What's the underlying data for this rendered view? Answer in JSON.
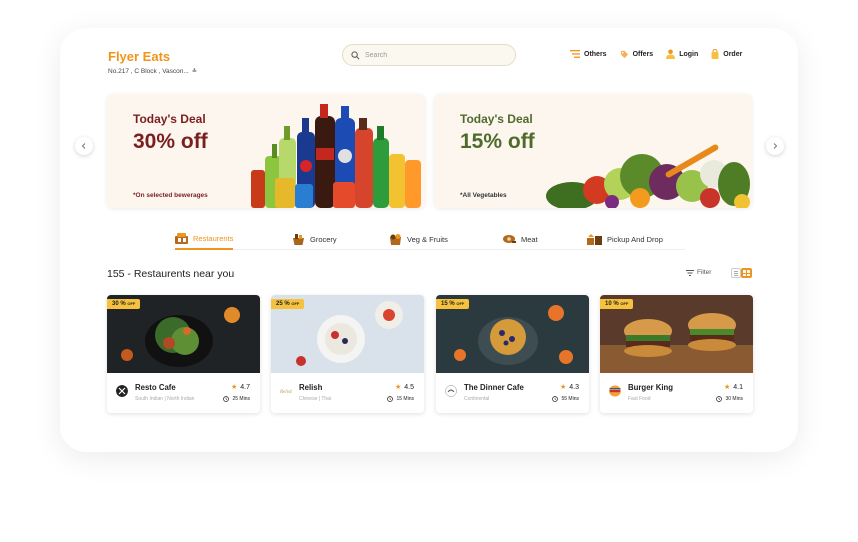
{
  "header": {
    "brand": "Flyer Eats",
    "address": "No.217 , C Block , Vascon...",
    "search_placeholder": "Search",
    "nav": [
      {
        "label": "Others",
        "icon": "menu-icon"
      },
      {
        "label": "Offers",
        "icon": "tag-icon"
      },
      {
        "label": "Login",
        "icon": "user-icon"
      },
      {
        "label": "Order",
        "icon": "bag-icon"
      }
    ]
  },
  "banners": [
    {
      "title": "Today's Deal",
      "discount": "30% off",
      "note": "*On selected bewerages",
      "color": "#7a1f1f"
    },
    {
      "title": "Today's Deal",
      "discount": "15% off",
      "note": "*All Vegetables",
      "color": "#4e6b2c"
    }
  ],
  "categories": [
    {
      "label": "Restaurents",
      "icon": "restaurant-icon",
      "active": true
    },
    {
      "label": "Grocery",
      "icon": "grocery-icon",
      "active": false
    },
    {
      "label": "Veg & Fruits",
      "icon": "veg-fruits-icon",
      "active": false
    },
    {
      "label": "Meat",
      "icon": "meat-icon",
      "active": false
    },
    {
      "label": "Pickup And Drop",
      "icon": "pickup-drop-icon",
      "active": false
    }
  ],
  "section_title": "155 - Restaurents near you",
  "filter_label": "Filter",
  "restaurants": [
    {
      "discount": "30 %",
      "off": "OFF",
      "name": "Resto Cafe",
      "cuisine": "South Indian  |  North Indian",
      "rating": "4.7",
      "time": "25 Mins"
    },
    {
      "discount": "25 %",
      "off": "OFF",
      "name": "Relish",
      "cuisine": "Chinese  |  Thai",
      "rating": "4.5",
      "time": "15 Mins"
    },
    {
      "discount": "15 %",
      "off": "OFF",
      "name": "The Dinner Cafe",
      "cuisine": "Continental",
      "rating": "4.3",
      "time": "55 Mins"
    },
    {
      "discount": "10 %",
      "off": "OFF",
      "name": "Burger King",
      "cuisine": "Fast Food",
      "rating": "4.1",
      "time": "30 Mins"
    }
  ],
  "colors": {
    "accent": "#f0941b",
    "badge": "#f6c23e"
  }
}
